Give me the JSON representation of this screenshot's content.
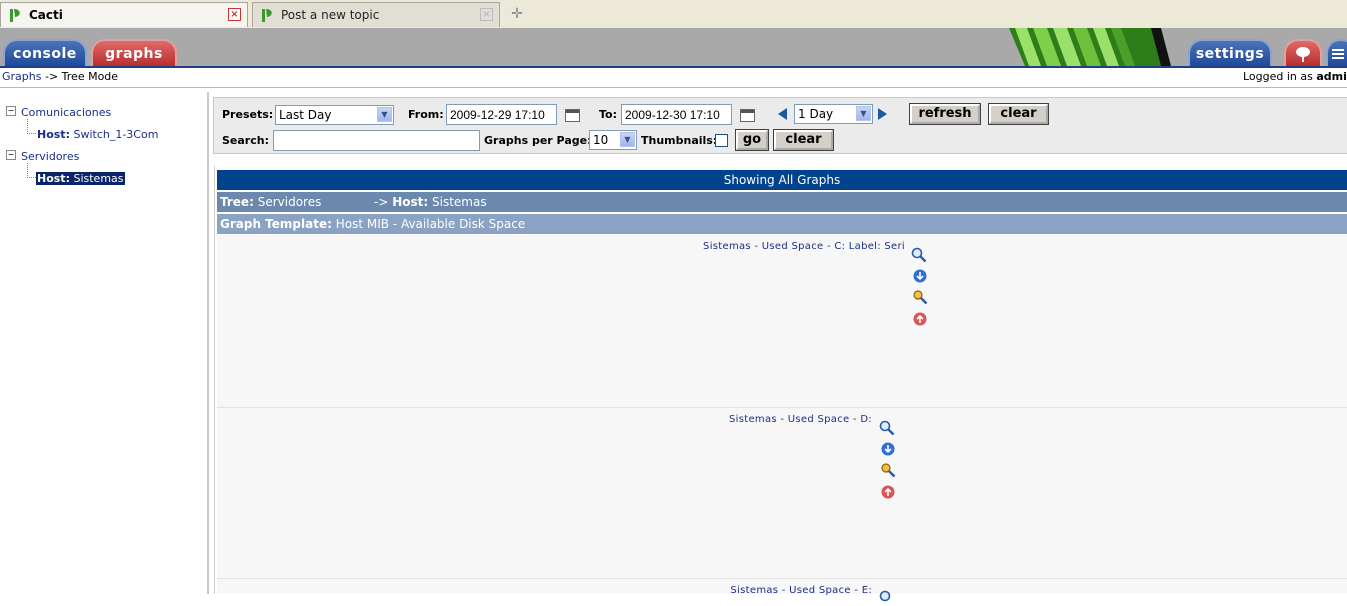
{
  "browser_tabs": [
    {
      "title": "Cacti",
      "active": true
    },
    {
      "title": "Post a new topic",
      "active": false
    }
  ],
  "nav": {
    "console_label": "console",
    "graphs_label": "graphs",
    "settings_label": "settings"
  },
  "breadcrumb": {
    "graphs_link": "Graphs",
    "rest": "-> Tree Mode",
    "logged_in": "Logged in as ",
    "user": "admi"
  },
  "tree": {
    "nodes": [
      {
        "label": "Comunicaciones"
      },
      {
        "prefix": "Host:",
        "label": "Switch_1-3Com"
      },
      {
        "label": "Servidores"
      },
      {
        "prefix": "Host:",
        "label": "Sistemas",
        "selected": true
      }
    ]
  },
  "filter": {
    "presets_label": "Presets:",
    "presets_value": "Last Day",
    "from_label": "From:",
    "from_value": "2009-12-29 17:10",
    "to_label": "To:",
    "to_value": "2009-12-30 17:10",
    "timespan_value": "1 Day",
    "refresh_label": "refresh",
    "clear_label": "clear",
    "search_label": "Search:",
    "search_value": "",
    "graphs_per_page_label": "Graphs per Page:",
    "graphs_per_page_value": "10",
    "thumbnails_label": "Thumbnails:",
    "thumbnails_checked": false,
    "go_label": "go",
    "clear2_label": "clear"
  },
  "graphs": {
    "showing_all": "Showing All Graphs",
    "tree_label": "Tree:",
    "tree_value": "Servidores",
    "host_arrow": "-> ",
    "host_label": "Host:",
    "host_value": "Sistemas",
    "template_label": "Graph Template:",
    "template_value": "Host MIB - Available Disk Space",
    "items": [
      {
        "title": "Sistemas - Used Space - C: Label: Seri"
      },
      {
        "title": "Sistemas - Used Space - D:"
      },
      {
        "title": "Sistemas - Used Space - E:"
      }
    ]
  },
  "colors": {
    "header_blue": "#00438c",
    "tab_red": "#b82e2e",
    "link_blue": "#1a2e88"
  }
}
